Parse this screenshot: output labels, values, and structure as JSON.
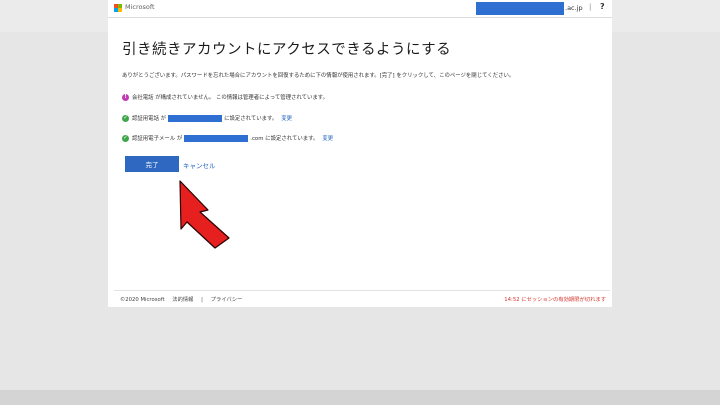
{
  "header": {
    "brand": "Microsoft",
    "account_suffix": ".ac.jp",
    "separator": "|",
    "help": "?"
  },
  "main": {
    "title": "引き続きアカウントにアクセスできるようにする",
    "intro": "ありがとうございます。パスワードを忘れた場合にアカウントを回復するために下の情報が使用されます。[完了] をクリックして、このページを閉じてください。",
    "items": [
      {
        "icon": "warning-icon",
        "text": "会社電話 が構成されていません。 この情報は管理者によって管理されています。"
      },
      {
        "icon": "check-icon",
        "prefix": "認証用電話 が",
        "suffix": "に設定されています。",
        "link": "変更"
      },
      {
        "icon": "check-icon",
        "prefix": "認証用電子メール が",
        "suffix": ".com に設定されています。",
        "link": "変更"
      }
    ],
    "done_label": "完了",
    "cancel_label": "キャンセル"
  },
  "footer": {
    "copyright": "©2020 Microsoft",
    "legal": "法的情報",
    "divider": "|",
    "privacy": "プライバシー",
    "session_warning": "14:52 にセッションの有効期限が切れます"
  },
  "colors": {
    "accent": "#2f68c0",
    "link": "#2065c0",
    "warning": "#c239b3",
    "ok": "#3fa64a",
    "session_warning": "#d6362c",
    "redaction": "#2f6fd1",
    "arrow": "#e5201f"
  }
}
